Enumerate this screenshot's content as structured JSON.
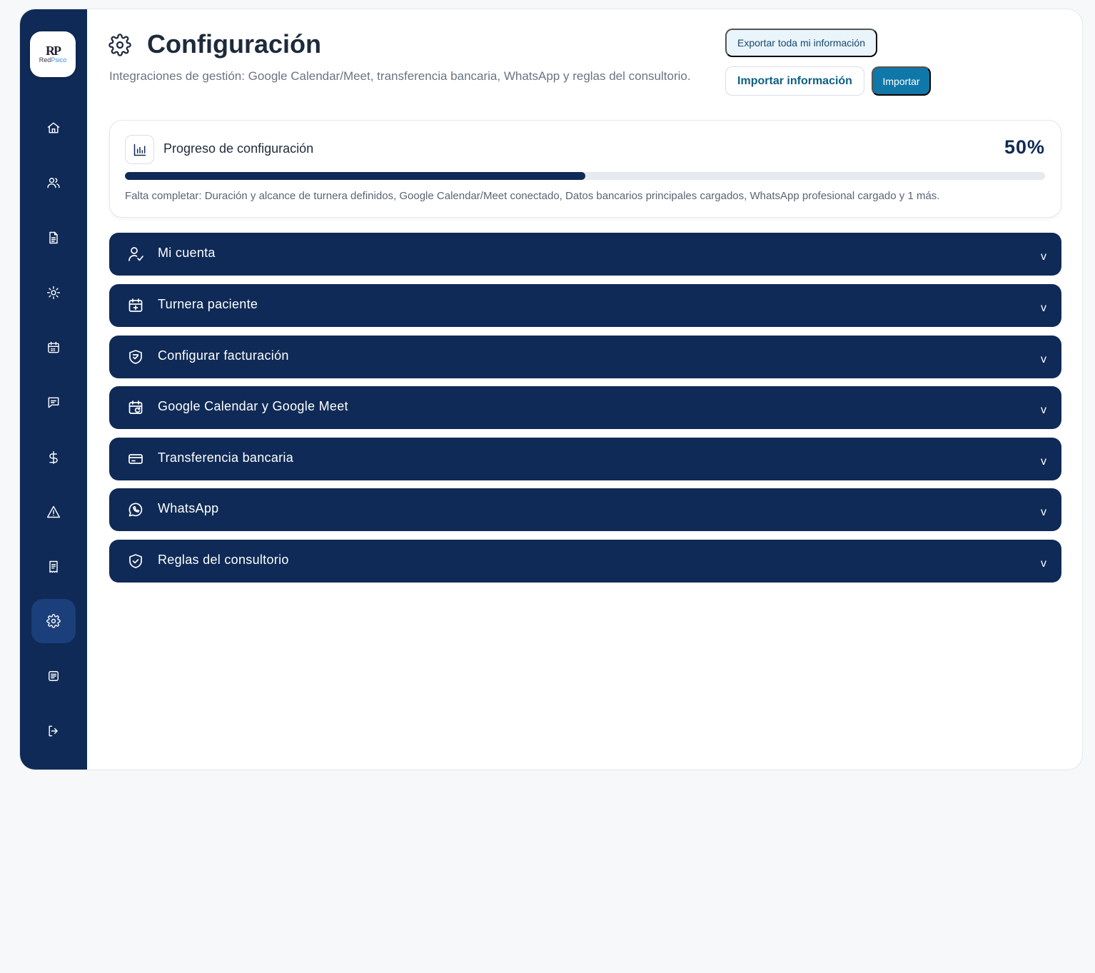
{
  "logo": {
    "mark": "RP",
    "text_main": "Red",
    "text_accent": "Psico"
  },
  "sidebar": {
    "items": [
      {
        "name": "home",
        "icon": "home-icon"
      },
      {
        "name": "patients",
        "icon": "users-icon"
      },
      {
        "name": "documents",
        "icon": "document-icon"
      },
      {
        "name": "sessions",
        "icon": "sun-icon"
      },
      {
        "name": "calendar",
        "icon": "calendar-icon"
      },
      {
        "name": "messages",
        "icon": "message-icon"
      },
      {
        "name": "payments",
        "icon": "dollar-icon"
      },
      {
        "name": "alerts",
        "icon": "alert-triangle-icon"
      },
      {
        "name": "receipts",
        "icon": "receipt-icon"
      },
      {
        "name": "settings",
        "icon": "gear-icon",
        "active": true
      },
      {
        "name": "notes",
        "icon": "list-icon"
      },
      {
        "name": "logout",
        "icon": "logout-icon"
      }
    ]
  },
  "header": {
    "title": "Configuración",
    "subtitle": "Integraciones de gestión: Google Calendar/Meet, transferencia bancaria, WhatsApp y reglas del consultorio.",
    "export_label": "Exportar toda mi información",
    "import_info_label": "Importar información",
    "import_label": "Importar"
  },
  "progress": {
    "title": "Progreso de configuración",
    "percent_label": "50%",
    "value": 0.5,
    "note": "Falta completar: Duración y alcance de turnera definidos, Google Calendar/Meet conectado, Datos bancarios principales cargados, WhatsApp profesional cargado y 1 más."
  },
  "sections": [
    {
      "label": "Mi cuenta",
      "icon": "user-check-icon"
    },
    {
      "label": "Turnera paciente",
      "icon": "calendar-plus-icon"
    },
    {
      "label": "Configurar facturación",
      "icon": "shield-receipt-icon"
    },
    {
      "label": "Google Calendar y Google Meet",
      "icon": "calendar-sync-icon"
    },
    {
      "label": "Transferencia bancaria",
      "icon": "credit-card-icon"
    },
    {
      "label": "WhatsApp",
      "icon": "whatsapp-icon"
    },
    {
      "label": "Reglas del consultorio",
      "icon": "shield-check-icon"
    }
  ],
  "chevron": "v",
  "colors": {
    "primary": "#0f2a56",
    "accent": "#0f78a8",
    "background": "#f6f8fa"
  }
}
